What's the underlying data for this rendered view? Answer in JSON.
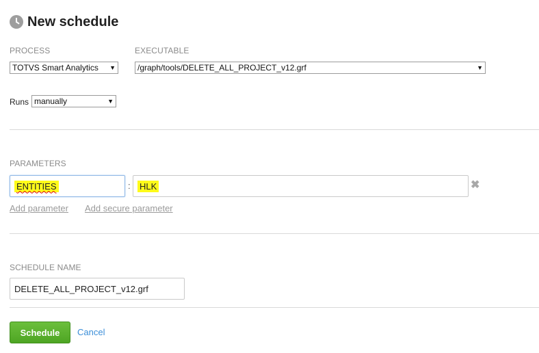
{
  "header": {
    "title": "New schedule",
    "icon": "clock-icon"
  },
  "process": {
    "label": "PROCESS",
    "selected": "TOTVS Smart Analytics"
  },
  "executable": {
    "label": "EXECUTABLE",
    "selected": "/graph/tools/DELETE_ALL_PROJECT_v12.grf"
  },
  "runs": {
    "label": "Runs",
    "selected": "manually"
  },
  "parameters": {
    "label": "PARAMETERS",
    "items": [
      {
        "key": "ENTITIES",
        "separator": ":",
        "value": "HLK"
      }
    ],
    "add_parameter": "Add parameter",
    "add_secure_parameter": "Add secure parameter"
  },
  "schedule_name": {
    "label": "SCHEDULE NAME",
    "value": "DELETE_ALL_PROJECT_v12.grf"
  },
  "actions": {
    "schedule": "Schedule",
    "cancel": "Cancel"
  },
  "colors": {
    "accent_green": "#5cb22d",
    "link_blue": "#3b8ed8",
    "highlight": "#fffb1a"
  }
}
